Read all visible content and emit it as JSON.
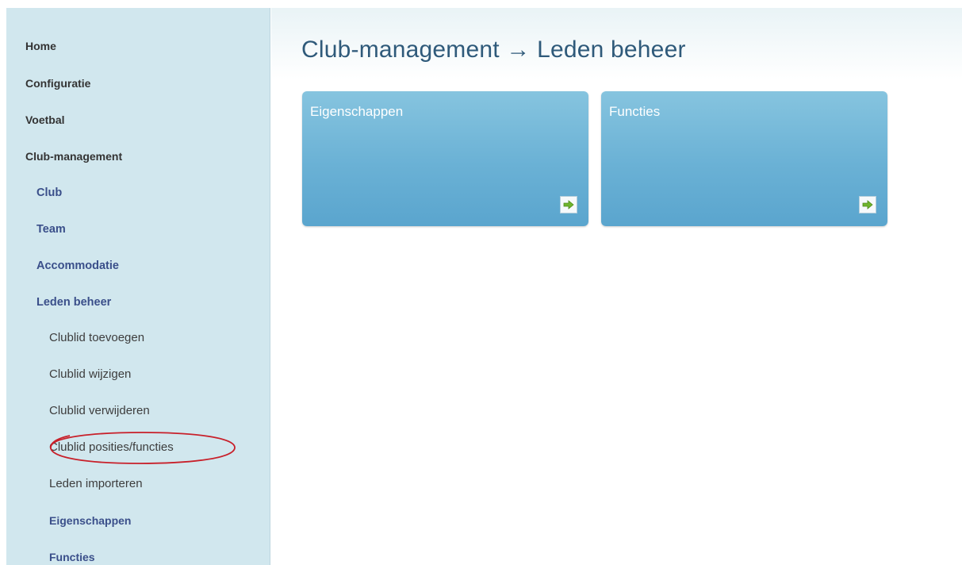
{
  "sidebar": {
    "items": [
      {
        "label": "Home"
      },
      {
        "label": "Configuratie"
      },
      {
        "label": "Voetbal"
      },
      {
        "label": "Club-management"
      },
      {
        "label": "Club"
      },
      {
        "label": "Team"
      },
      {
        "label": "Accommodatie"
      },
      {
        "label": "Leden beheer"
      },
      {
        "label": "Clublid toevoegen"
      },
      {
        "label": "Clublid wijzigen"
      },
      {
        "label": "Clublid verwijderen"
      },
      {
        "label": "Clublid posities/functies"
      },
      {
        "label": "Leden importeren"
      },
      {
        "label": "Eigenschappen"
      },
      {
        "label": "Functies"
      }
    ]
  },
  "header": {
    "title": "Club-management → Leden beheer"
  },
  "tiles": [
    {
      "title": "Eigenschappen",
      "icon": "arrow-right-icon"
    },
    {
      "title": "Functies",
      "icon": "arrow-right-icon"
    }
  ],
  "colors": {
    "sidebar_bg": "#d1e7ee",
    "link_blue": "#3a4f8a",
    "tile_blue": "#6ab1d5",
    "annotation_red": "#c8202a",
    "arrow_green": "#6fb52c"
  }
}
